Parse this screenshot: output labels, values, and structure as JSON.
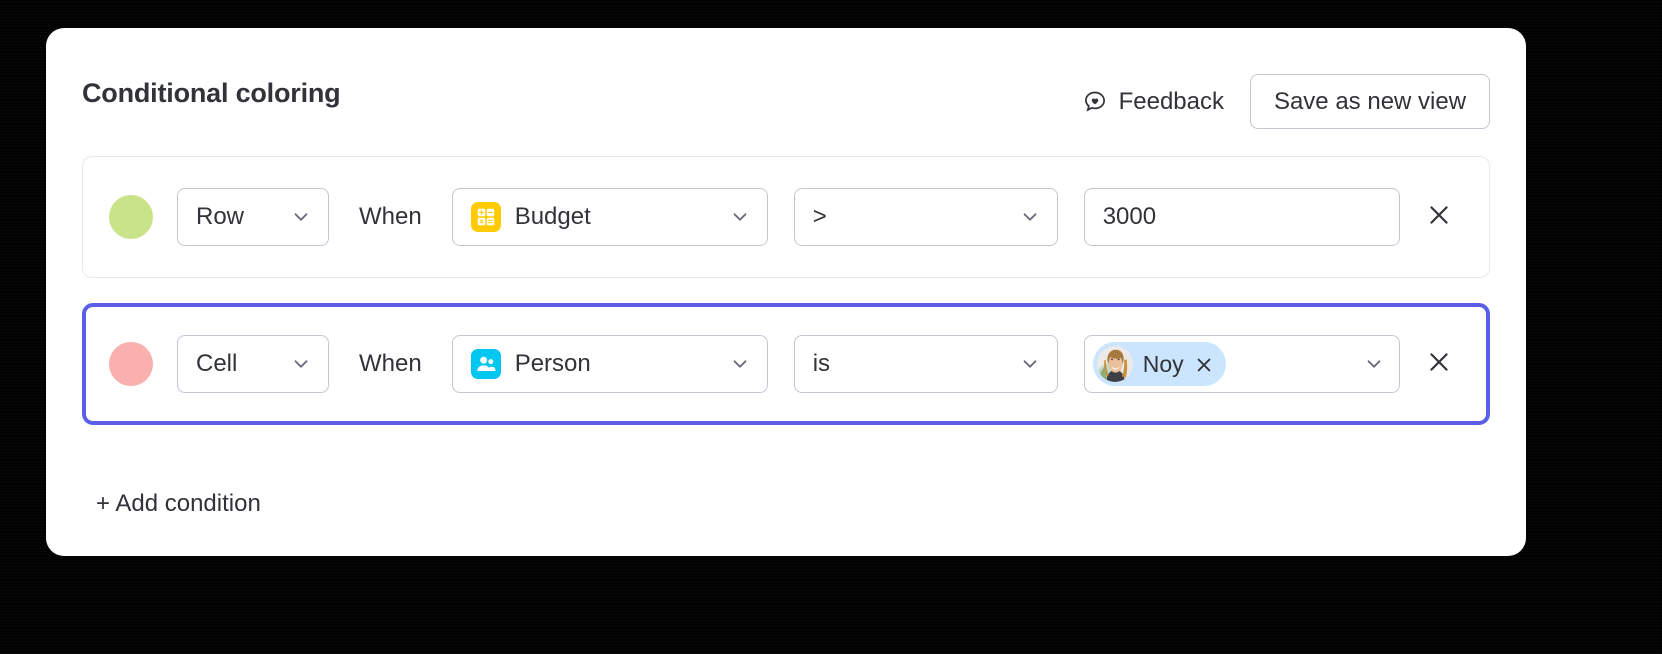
{
  "header": {
    "title": "Conditional coloring",
    "feedback_label": "Feedback",
    "feedback_icon": "speech-bubble-heart-icon",
    "save_view_label": "Save as new view"
  },
  "labels": {
    "when": "When",
    "add_condition": "+ Add condition",
    "remove_icon": "close-icon",
    "chevron_icon": "chevron-down-icon"
  },
  "colors": {
    "accent_focus": "#5b5fe8",
    "row1_swatch": "#c9e389",
    "row2_swatch": "#fab0ac",
    "budget_icon_bg": "#ffcb00",
    "person_icon_bg": "#00c7f0",
    "chip_bg": "#cce5ff",
    "border": "#c5c7d0",
    "text": "#323338"
  },
  "conditions": [
    {
      "swatch_color": "#c9e389",
      "scope": "Row",
      "when": "When",
      "field": "Budget",
      "field_icon": "numbers-calculator-icon",
      "operator": ">",
      "value": "3000",
      "value_type": "text",
      "focused": false
    },
    {
      "swatch_color": "#fab0ac",
      "scope": "Cell",
      "when": "When",
      "field": "Person",
      "field_icon": "people-icon",
      "operator": "is",
      "value_type": "chip",
      "chip": {
        "name": "Noy",
        "avatar": "woman-portrait-avatar"
      },
      "focused": true
    }
  ]
}
